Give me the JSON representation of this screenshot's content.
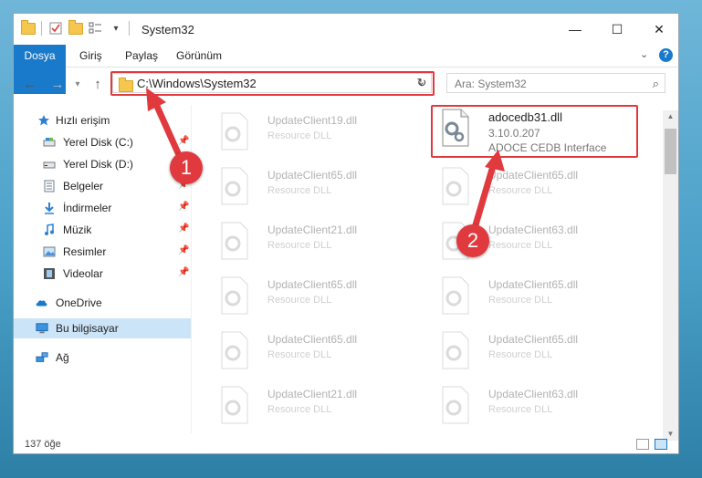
{
  "window": {
    "title": "System32",
    "controls": {
      "minimize": "—",
      "maximize": "☐",
      "close": "✕"
    }
  },
  "ribbon": {
    "tabs": [
      "Dosya",
      "Giriş",
      "Paylaş",
      "Görünüm"
    ],
    "expand": "⌄",
    "help": "?"
  },
  "address": {
    "path": "C:\\Windows\\System32",
    "dropdown": "⌄",
    "refresh": "↻"
  },
  "search": {
    "placeholder": "Ara: System32",
    "icon": "⌕"
  },
  "nav": {
    "back": "←",
    "forward": "→",
    "up": "↑"
  },
  "sidebar": {
    "items": [
      {
        "label": "Hızlı erişim",
        "icon": "star-icon",
        "pinned": false
      },
      {
        "label": "Yerel Disk (C:)",
        "icon": "drive-icon",
        "pinned": true
      },
      {
        "label": "Yerel Disk (D:)",
        "icon": "drive-icon",
        "pinned": false
      },
      {
        "label": "Belgeler",
        "icon": "document-icon",
        "pinned": true
      },
      {
        "label": "İndirmeler",
        "icon": "download-icon",
        "pinned": true
      },
      {
        "label": "Müzik",
        "icon": "music-icon",
        "pinned": true
      },
      {
        "label": "Resimler",
        "icon": "picture-icon",
        "pinned": true
      },
      {
        "label": "Videolar",
        "icon": "video-icon",
        "pinned": true
      },
      {
        "label": "OneDrive",
        "icon": "cloud-icon",
        "pinned": false
      },
      {
        "label": "Bu bilgisayar",
        "icon": "computer-icon",
        "pinned": false
      },
      {
        "label": "Ağ",
        "icon": "network-icon",
        "pinned": false
      }
    ],
    "pin_glyph": "📌"
  },
  "files": {
    "highlighted": {
      "name": "adocedb31.dll",
      "version": "3.10.0.207",
      "description": "ADOCE CEDB Interface"
    },
    "left_column": [
      {
        "name": "UpdateClient19.dll",
        "type": "Resource DLL"
      },
      {
        "name": "UpdateClient65.dll",
        "type": "Resource DLL"
      },
      {
        "name": "UpdateClient21.dll",
        "type": "Resource DLL"
      },
      {
        "name": "UpdateClient65.dll",
        "type": "Resource DLL"
      },
      {
        "name": "UpdateClient65.dll",
        "type": "Resource DLL"
      },
      {
        "name": "UpdateClient21.dll",
        "type": "Resource DLL"
      }
    ],
    "right_column": [
      {
        "name": "UpdateClient65.dll",
        "type": "Resource DLL"
      },
      {
        "name": "UpdateClient63.dll",
        "type": "Resource DLL"
      },
      {
        "name": "UpdateClient65.dll",
        "type": "Resource DLL"
      },
      {
        "name": "UpdateClient65.dll",
        "type": "Resource DLL"
      },
      {
        "name": "UpdateClient63.dll",
        "type": "Resource DLL"
      }
    ]
  },
  "status": {
    "count": "137 öğe"
  },
  "callouts": {
    "one": "1",
    "two": "2"
  },
  "colors": {
    "accent": "#1979ca",
    "highlight": "#e0393e",
    "selected": "#cce4f7"
  }
}
